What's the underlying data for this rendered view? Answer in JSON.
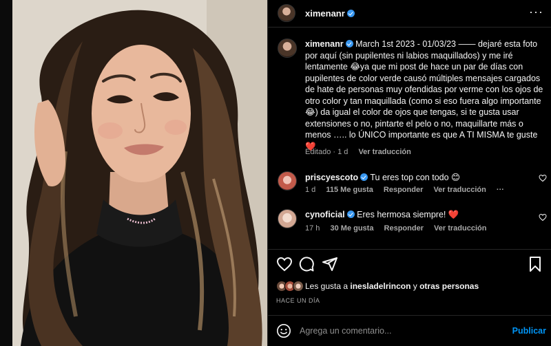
{
  "post": {
    "username": "ximenanr",
    "caption_text": "March 1st 2023 - 01/03/23 —— dejaré esta foto por aquí (sin pupilentes ni labios maquillados) y me iré lentamente 😂ya que mi post de hace un par de días con pupilentes de color verde causó múltiples mensajes cargados de hate de personas muy ofendidas por verme con los ojos de otro color y tan maquillada (como si eso fuera algo importante 😂) da igual el color de ojos que tengas, si te gusta usar extensiones o no, pintarte el pelo o no, maquillarte más o menos ….. lo ÚNICO importante es que A TI MISMA te guste ❤️",
    "caption_meta_edited": "Editado · 1 d",
    "caption_meta_translate": "Ver traducción"
  },
  "comments": [
    {
      "username": "priscyescoto",
      "text": "Tu eres top con todo 😊",
      "age": "1 d",
      "likes": "115 Me gusta",
      "reply": "Responder",
      "translate": "Ver traducción",
      "more": "···"
    },
    {
      "username": "cynoficial",
      "text": "Eres hermosa siempre! ❤️",
      "age": "17 h",
      "likes": "30 Me gusta",
      "reply": "Responder",
      "translate": "Ver traducción"
    }
  ],
  "actions": {
    "icons": [
      "heart-icon",
      "comment-icon",
      "share-icon",
      "bookmark-icon"
    ]
  },
  "likes": {
    "prefix": "Les gusta a ",
    "user": "inesladelrincon",
    "middle": " y ",
    "others": "otras personas"
  },
  "timestamp": "HACE UN DÍA",
  "composer": {
    "placeholder": "Agrega un comentario...",
    "publish": "Publicar",
    "emoji_icon": "smiley-icon"
  },
  "header": {
    "more_icon": "more-horizontal-icon",
    "more_label": "···"
  },
  "colors": {
    "accent": "#0095f6",
    "verified": "#3897f0",
    "muted": "#a8a8a8",
    "heart_red": "#ed4956"
  }
}
